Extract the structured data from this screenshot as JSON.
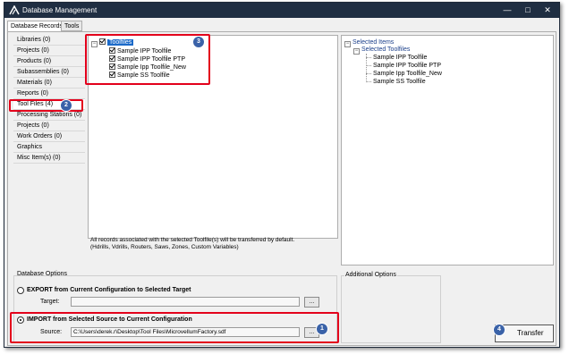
{
  "window": {
    "title": "Database Management",
    "minimize_glyph": "—",
    "maximize_glyph": "□",
    "close_glyph": "✕"
  },
  "tabs": [
    {
      "label": "Database Records",
      "active": true
    },
    {
      "label": "Tools",
      "active": false
    }
  ],
  "sidebar": {
    "items": [
      {
        "label": "Libraries (0)"
      },
      {
        "label": "Projects (0)"
      },
      {
        "label": "Products (0)"
      },
      {
        "label": "Subassemblies (0)"
      },
      {
        "label": "Materials (0)"
      },
      {
        "label": "Reports (0)"
      },
      {
        "label": "Tool Files (4)",
        "selected": true
      },
      {
        "label": "Processing Stations (0)"
      },
      {
        "label": "Projects (0)"
      },
      {
        "label": "Work Orders (0)"
      },
      {
        "label": "Graphics"
      },
      {
        "label": "Misc Item(s) (0)"
      }
    ]
  },
  "source_tree": {
    "root": {
      "label": "Toolfiles",
      "expander": "−"
    },
    "items": [
      {
        "label": "Sample IPP Toolfile"
      },
      {
        "label": "Sample IPP Toolfile PTP"
      },
      {
        "label": "Sample Ipp Toolfile_New"
      },
      {
        "label": "Sample SS Toolfile"
      }
    ],
    "note_line1": "All records associated with the selected Toolfile(s) will be transferred by default.",
    "note_line2": "(Hdrills, Vdrills, Routers, Saws, Zones, Custom Variables)"
  },
  "selected_tree": {
    "root": {
      "label": "Selected Items",
      "expander": "−"
    },
    "group": {
      "label": "Selected Toolfiles",
      "expander": "−"
    },
    "items": [
      {
        "label": "Sample IPP Toolfile"
      },
      {
        "label": "Sample IPP Toolfile PTP"
      },
      {
        "label": "Sample Ipp Toolfile_New"
      },
      {
        "label": "Sample SS Toolfile"
      }
    ]
  },
  "database_options": {
    "label": "Database Options",
    "export": {
      "label": "EXPORT from Current Configuration to Selected Target",
      "field_label": "Target:",
      "value": "",
      "browse_label": "...",
      "checked": false
    },
    "import": {
      "label": "IMPORT from Selected Source to Current Configuration",
      "field_label": "Source:",
      "value": "C:\\Users\\derek.r\\Desktop\\Tool Files\\MicrovellumFactory.sdf",
      "browse_label": "...",
      "checked": true
    }
  },
  "additional_options": {
    "label": "Additional Options"
  },
  "transfer_button": {
    "label": "Transfer"
  },
  "callouts": {
    "import_badge": "1",
    "toolfiles_nav_badge": "2",
    "tree_badge": "3",
    "transfer_badge": "4",
    "color": "#e3001b",
    "badge_color": "#3a62a8"
  },
  "colors": {
    "titlebar": "#1f2e42",
    "tree_selection": "#1b6ac9",
    "window_bg": "#f0f0f0"
  }
}
